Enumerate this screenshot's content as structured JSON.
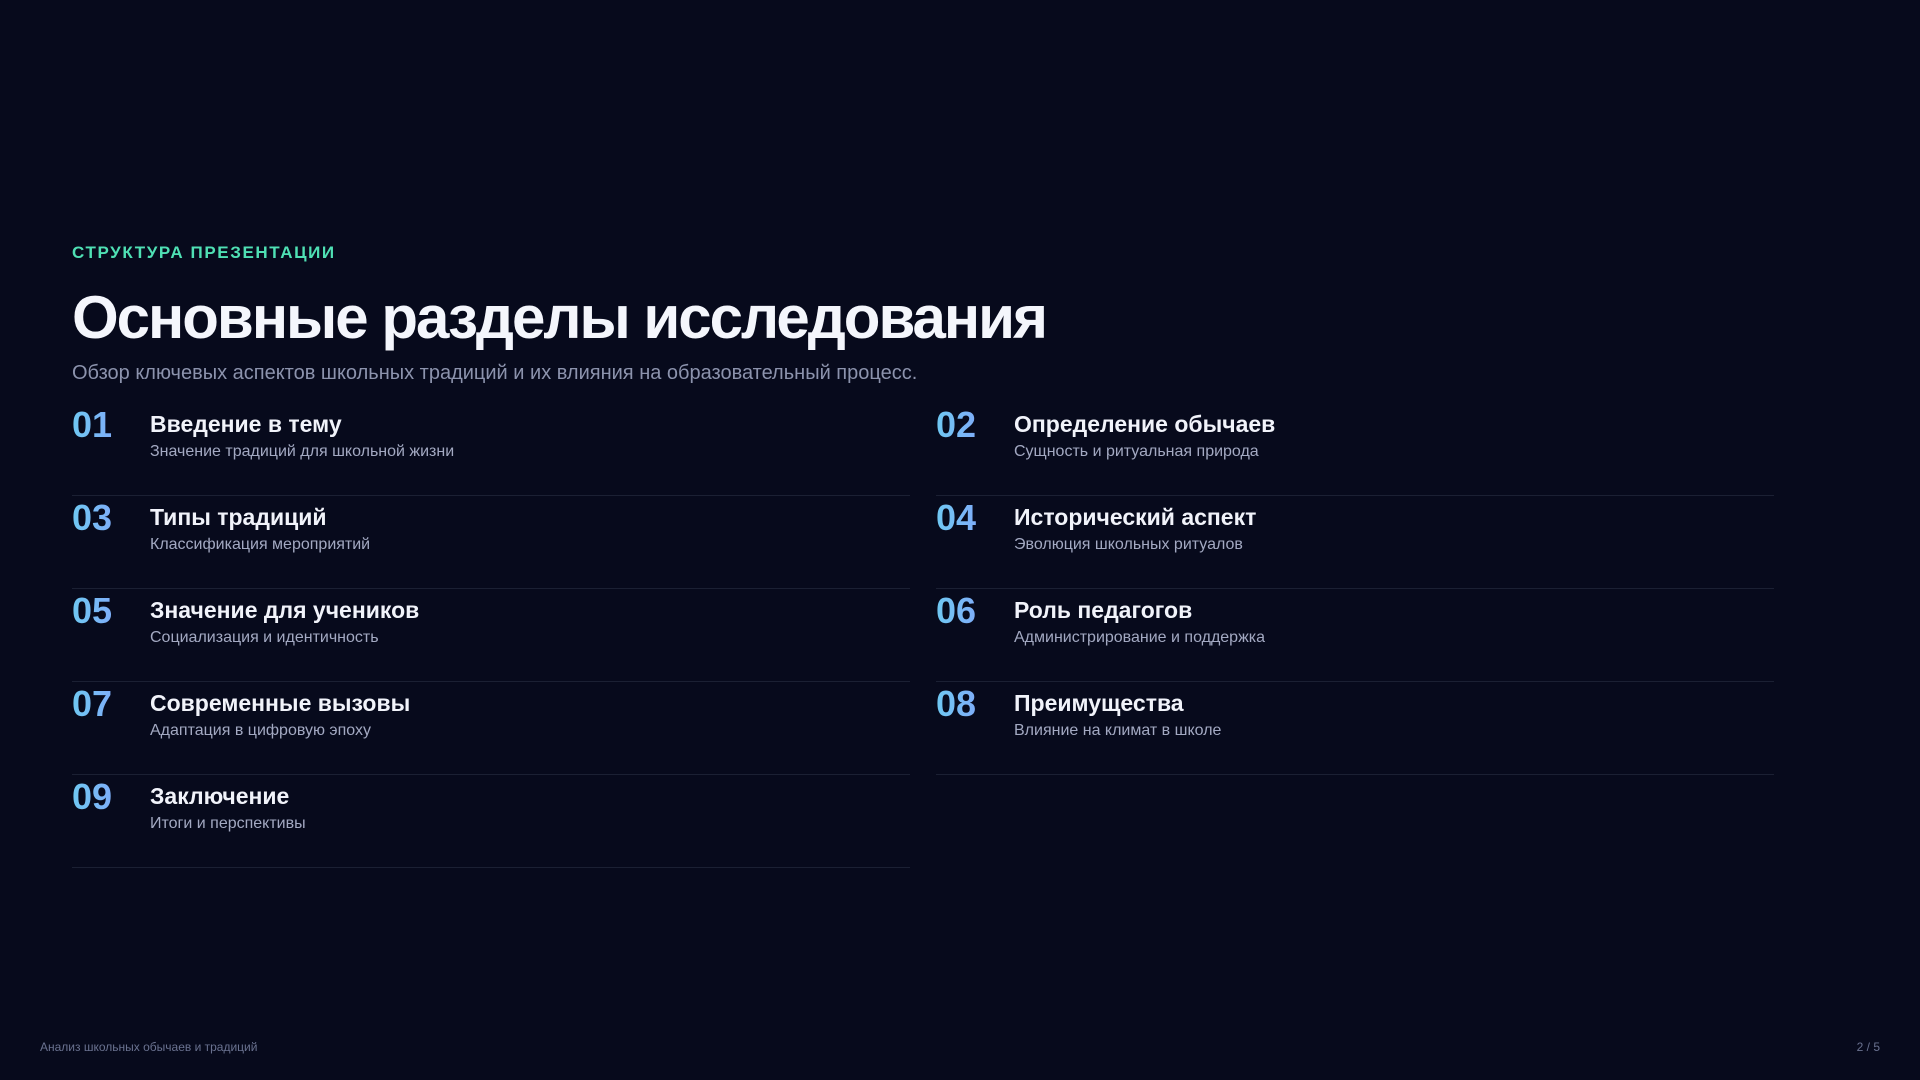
{
  "header": {
    "eyebrow": "СТРУКТУРА ПРЕЗЕНТАЦИИ",
    "title": "Основные разделы исследования",
    "subtitle": "Обзор ключевых аспектов школьных традиций и их влияния на образовательный процесс."
  },
  "sections": [
    {
      "num": "01",
      "title": "Введение в тему",
      "desc": "Значение традиций для школьной жизни"
    },
    {
      "num": "02",
      "title": "Определение обычаев",
      "desc": "Сущность и ритуальная природа"
    },
    {
      "num": "03",
      "title": "Типы традиций",
      "desc": "Классификация мероприятий"
    },
    {
      "num": "04",
      "title": "Исторический аспект",
      "desc": "Эволюция школьных ритуалов"
    },
    {
      "num": "05",
      "title": "Значение для учеников",
      "desc": "Социализация и идентичность"
    },
    {
      "num": "06",
      "title": "Роль педагогов",
      "desc": "Администрирование и поддержка"
    },
    {
      "num": "07",
      "title": "Современные вызовы",
      "desc": "Адаптация в цифровую эпоху"
    },
    {
      "num": "08",
      "title": "Преимущества",
      "desc": "Влияние на климат в школе"
    },
    {
      "num": "09",
      "title": "Заключение",
      "desc": "Итоги и перспективы"
    }
  ],
  "footer": {
    "left": "Анализ школьных обычаев и традиций",
    "page": "2 / 5"
  },
  "colors": {
    "background": "#070a1c",
    "accent": "#4fe0b4",
    "number_gradient_start": "#6fc8f2",
    "number_gradient_end": "#8c96ff"
  }
}
